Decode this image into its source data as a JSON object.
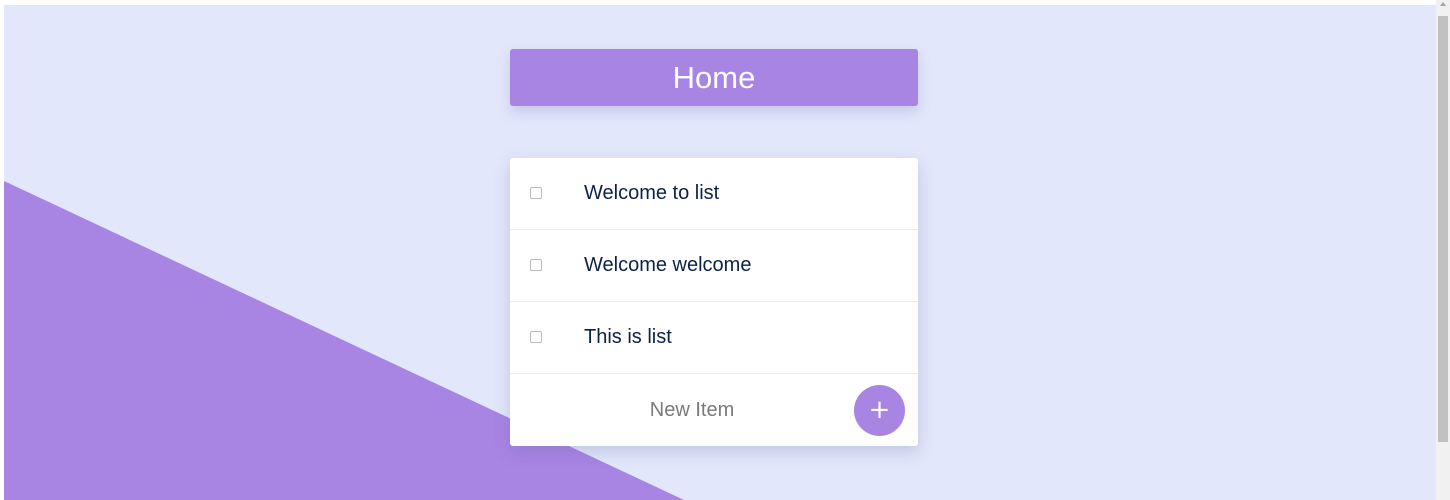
{
  "page": {
    "title": "Home"
  },
  "todo": {
    "items": [
      {
        "label": "Welcome to list",
        "checked": false
      },
      {
        "label": "Welcome welcome",
        "checked": false
      },
      {
        "label": "This is list",
        "checked": false
      }
    ],
    "new_item": {
      "placeholder": "New Item",
      "value": ""
    },
    "add_button": {
      "label": "+",
      "icon": "plus-icon"
    }
  },
  "colors": {
    "background": "#e2e7fb",
    "accent": "#a884e3",
    "card": "#ffffff",
    "item_text": "#0d2247"
  }
}
